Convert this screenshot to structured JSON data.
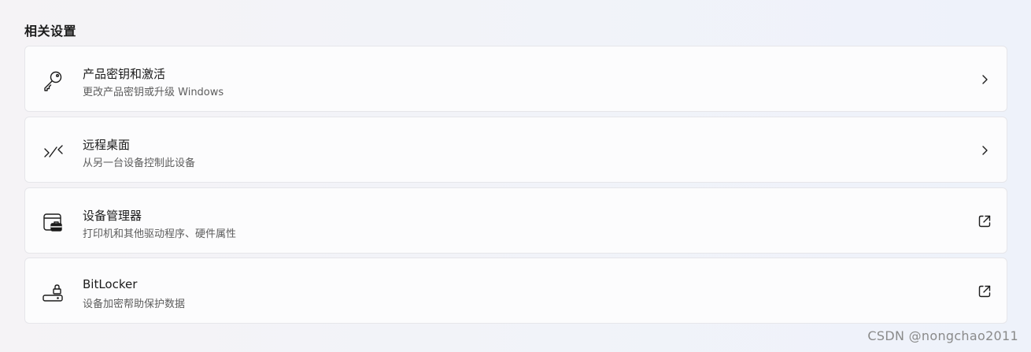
{
  "section": {
    "title": "相关设置"
  },
  "items": [
    {
      "title": "产品密钥和激活",
      "subtitle": "更改产品密钥或升级 Windows",
      "icon": "key-icon",
      "trailing_icon": "chevron-right-icon"
    },
    {
      "title": "远程桌面",
      "subtitle": "从另一台设备控制此设备",
      "icon": "remote-desktop-icon",
      "trailing_icon": "chevron-right-icon"
    },
    {
      "title": "设备管理器",
      "subtitle": "打印机和其他驱动程序、硬件属性",
      "icon": "device-manager-icon",
      "trailing_icon": "open-external-icon"
    },
    {
      "title": "BitLocker",
      "subtitle": "设备加密帮助保护数据",
      "icon": "bitlocker-drive-lock-icon",
      "trailing_icon": "open-external-icon"
    }
  ],
  "watermark": "CSDN @nongchao2011",
  "colors": {
    "card_background": "#fcfcfd",
    "card_border": "#e6e6ea",
    "title_text": "#1b1b1b",
    "subtitle_text": "#5d5d5d"
  }
}
